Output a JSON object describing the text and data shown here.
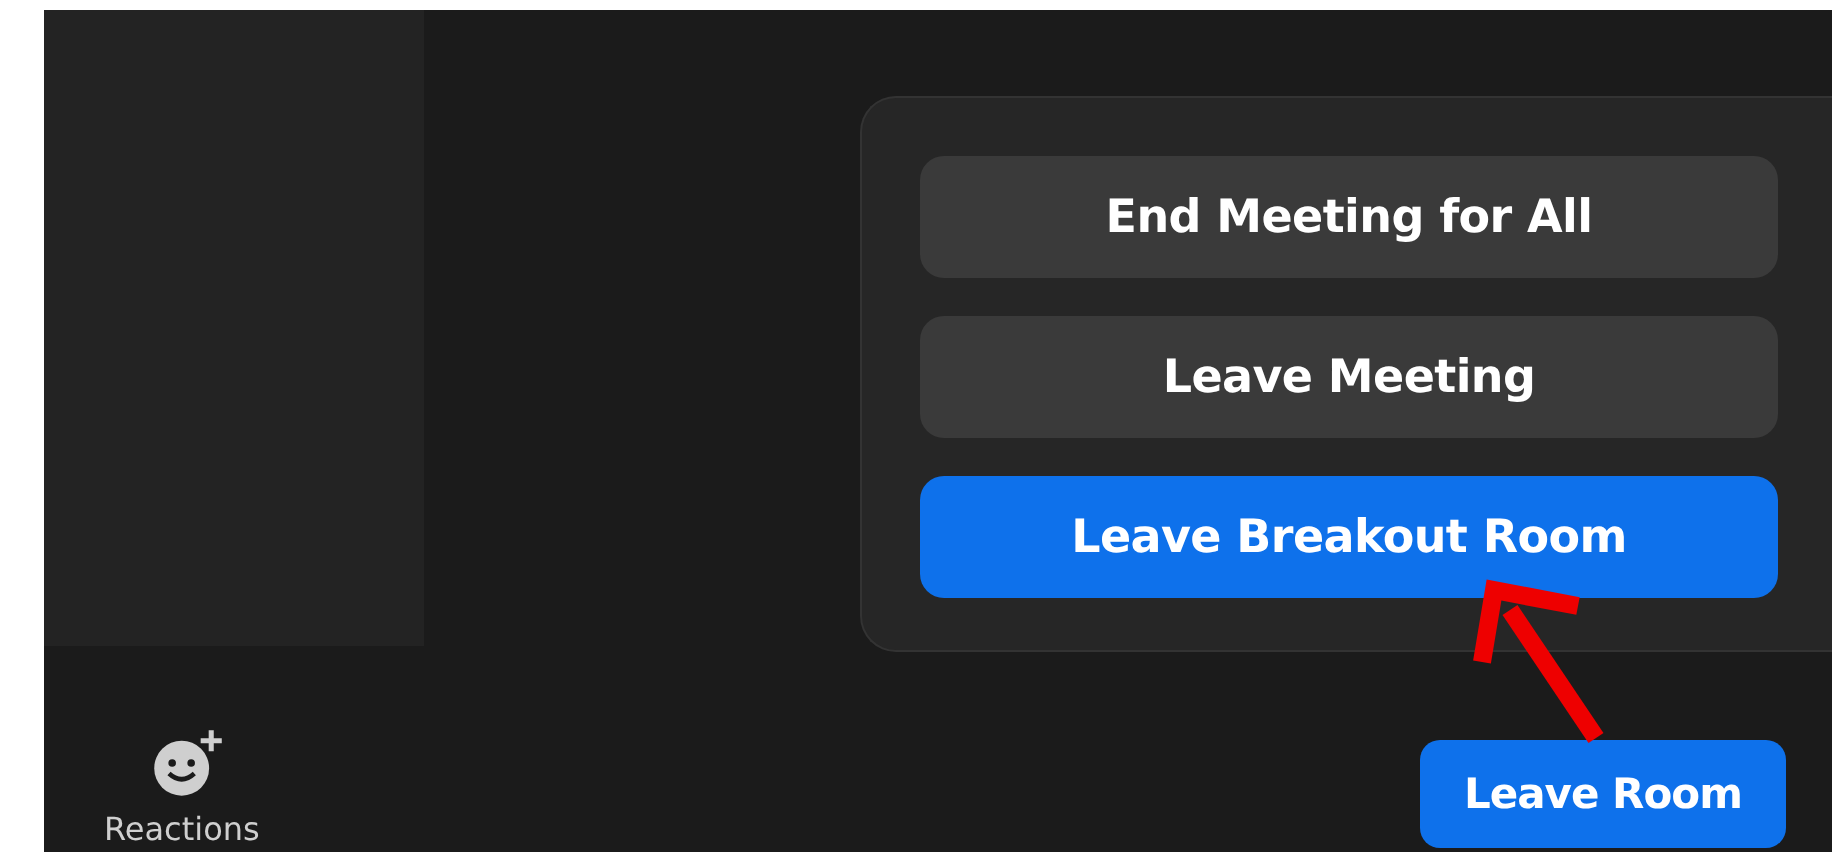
{
  "leave_menu": {
    "options": [
      {
        "label": "End Meeting for All",
        "kind": "secondary"
      },
      {
        "label": "Leave Meeting",
        "kind": "secondary"
      },
      {
        "label": "Leave Breakout Room",
        "kind": "primary"
      }
    ]
  },
  "toolbar": {
    "reactions": {
      "label": "Reactions"
    },
    "leave_button": {
      "label": "Leave Room"
    }
  }
}
